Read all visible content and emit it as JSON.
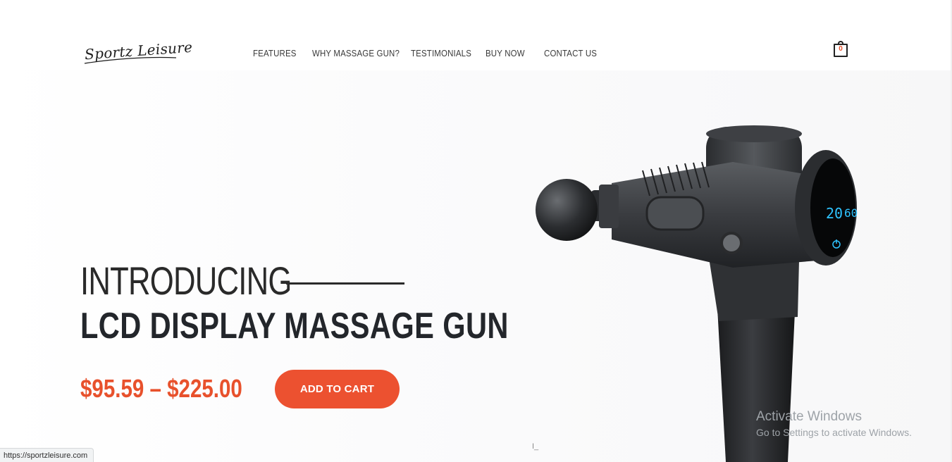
{
  "header": {
    "logo_text": "Sportz Leisure",
    "nav": [
      {
        "label": "FEATURES"
      },
      {
        "label": "WHY MASSAGE GUN?"
      },
      {
        "label": "TESTIMONIALS"
      },
      {
        "label": "BUY NOW"
      },
      {
        "label": "CONTACT US"
      }
    ],
    "cart": {
      "count": "0",
      "icon": "shopping-bag-icon"
    }
  },
  "hero": {
    "intro": "INTRODUCING",
    "headline": "LCD DISPLAY MASSAGE GUN",
    "price": "$95.59 – $225.00",
    "cta_label": "ADD TO CART",
    "product_display": {
      "left_value": "20",
      "right_value": "60",
      "power_icon": "power-icon"
    }
  },
  "colors": {
    "accent": "#ec5130",
    "price": "#e8512c",
    "text_dark": "#23262b"
  },
  "os_overlay": {
    "watermark_title": "Activate Windows",
    "watermark_sub": "Go to Settings to activate Windows."
  },
  "browser": {
    "status_url": "https://sportzleisure.com"
  }
}
